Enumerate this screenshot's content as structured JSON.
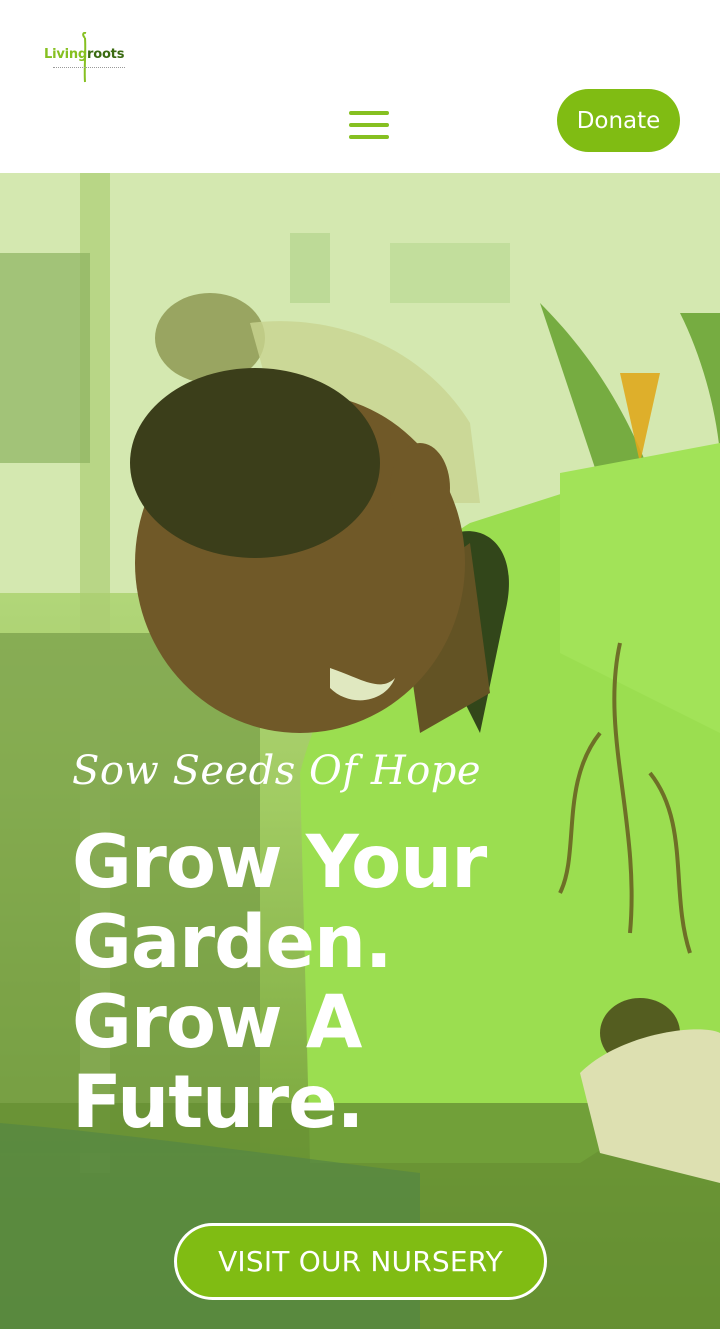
{
  "header": {
    "logo": {
      "left_word": "Living",
      "right_word": "roots",
      "icon": "sprout-stem-icon"
    },
    "menu_icon": "hamburger-menu-icon",
    "donate_label": "Donate"
  },
  "hero": {
    "tagline": "Sow Seeds Of Hope",
    "headline_lines": [
      "Grow Your",
      "Garden.",
      "Grow A",
      "Future."
    ],
    "cta_label": "VISIT OUR NURSERY"
  },
  "colors": {
    "brand_green": "#80bc13",
    "logo_dark_green": "#3b6b12",
    "white": "#ffffff"
  }
}
